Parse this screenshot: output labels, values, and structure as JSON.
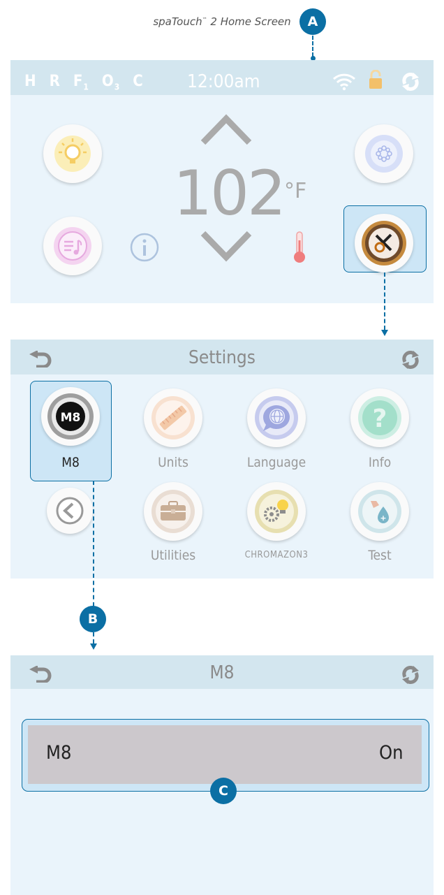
{
  "caption": {
    "text": "spaTouch",
    "tm": "™",
    "rest": " 2 Home Screen"
  },
  "markers": {
    "a": "A",
    "b": "B",
    "c": "C"
  },
  "home": {
    "status_letters": [
      "H",
      "R",
      "F",
      "O",
      "C"
    ],
    "status_subs": {
      "f": "1",
      "o": "3"
    },
    "clock": "12:00am",
    "temperature": "102",
    "unit": "°F"
  },
  "settings": {
    "title": "Settings",
    "tiles": [
      {
        "label": "M8",
        "badge": "M8"
      },
      {
        "label": "Units"
      },
      {
        "label": "Language"
      },
      {
        "label": "Info"
      },
      {
        "label": "Utilities"
      },
      {
        "label": "CHROMAZON3"
      },
      {
        "label": "Test"
      }
    ]
  },
  "m8": {
    "title": "M8",
    "row_label": "M8",
    "row_value": "On"
  },
  "colors": {
    "accent": "#0b6fa4",
    "screen_bg": "#eaf4fb",
    "bar_bg": "#d3e6ef",
    "row_bg": "#ccc8cc"
  }
}
